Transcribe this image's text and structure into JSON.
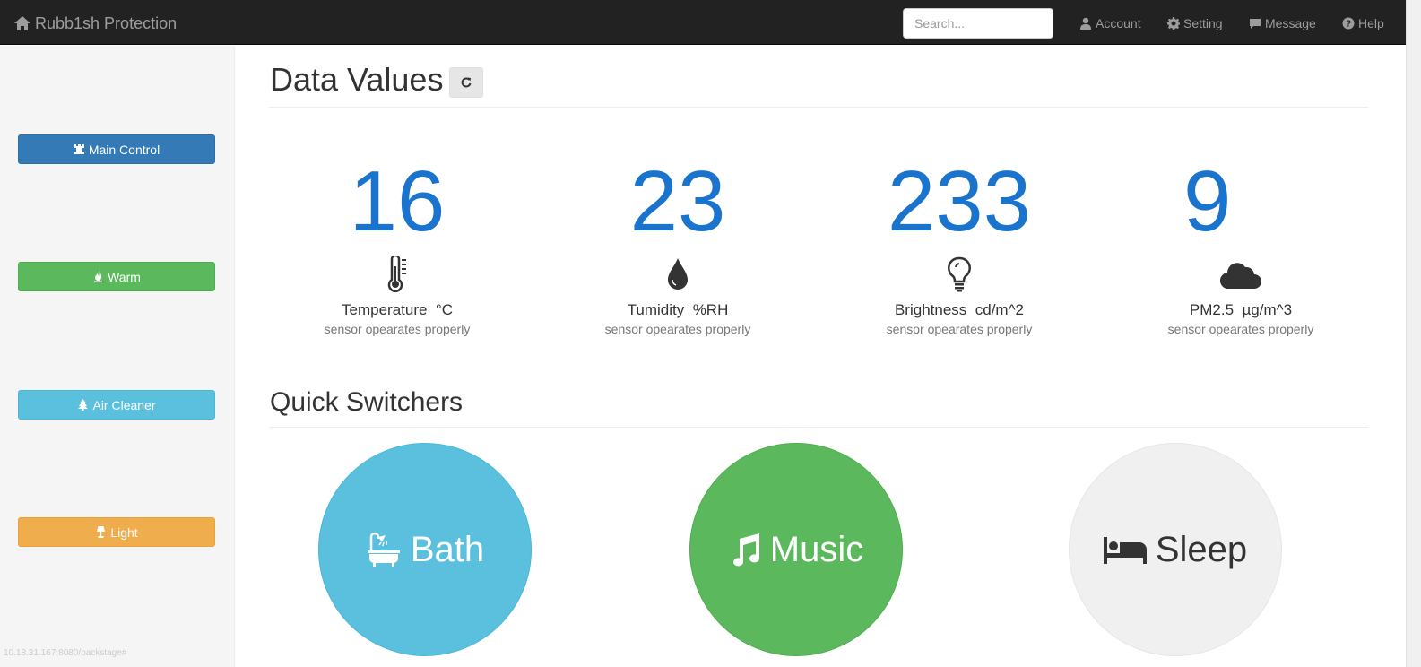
{
  "navbar": {
    "brand": "Rubb1sh Protection",
    "search_placeholder": "Search...",
    "links": [
      {
        "label": "Account",
        "icon": "user-icon"
      },
      {
        "label": "Setting",
        "icon": "gear-icon"
      },
      {
        "label": "Message",
        "icon": "comment-icon"
      },
      {
        "label": "Help",
        "icon": "question-circle-icon"
      }
    ]
  },
  "sidebar": {
    "buttons": [
      {
        "label": "Main Control",
        "icon": "tower-icon",
        "color": "#337ab7"
      },
      {
        "label": "Warm",
        "icon": "fire-icon",
        "color": "#5cb85c"
      },
      {
        "label": "Air Cleaner",
        "icon": "tree-icon",
        "color": "#5bc0de"
      },
      {
        "label": "Light",
        "icon": "lamp-icon",
        "color": "#f0ad4e"
      }
    ],
    "status_url": "10.18.31.167:8080/backstage#"
  },
  "data_values": {
    "title": "Data Values",
    "metrics": [
      {
        "value": "16",
        "label": "Temperature  °C",
        "status": "sensor opearates properly",
        "icon": "thermometer-icon"
      },
      {
        "value": "23",
        "label": "Tumidity  %RH",
        "status": "sensor opearates properly",
        "icon": "water-drop-icon"
      },
      {
        "value": "233",
        "label": "Brightness  cd/m^2",
        "status": "sensor opearates properly",
        "icon": "light-bulb-icon"
      },
      {
        "value": "9",
        "label": "PM2.5  µg/m^3",
        "status": "sensor opearates properly",
        "icon": "cloud-icon"
      }
    ]
  },
  "quick_switchers": {
    "title": "Quick Switchers",
    "items": [
      {
        "label": "Bath",
        "icon": "bathtub-icon",
        "color": "#5bc0de"
      },
      {
        "label": "Music",
        "icon": "music-note-icon",
        "color": "#5cb85c"
      },
      {
        "label": "Sleep",
        "icon": "bed-icon",
        "color": "#f0f0f0"
      }
    ]
  },
  "colors": {
    "navbar_bg": "#222222",
    "metric_value": "#1a73cc"
  }
}
